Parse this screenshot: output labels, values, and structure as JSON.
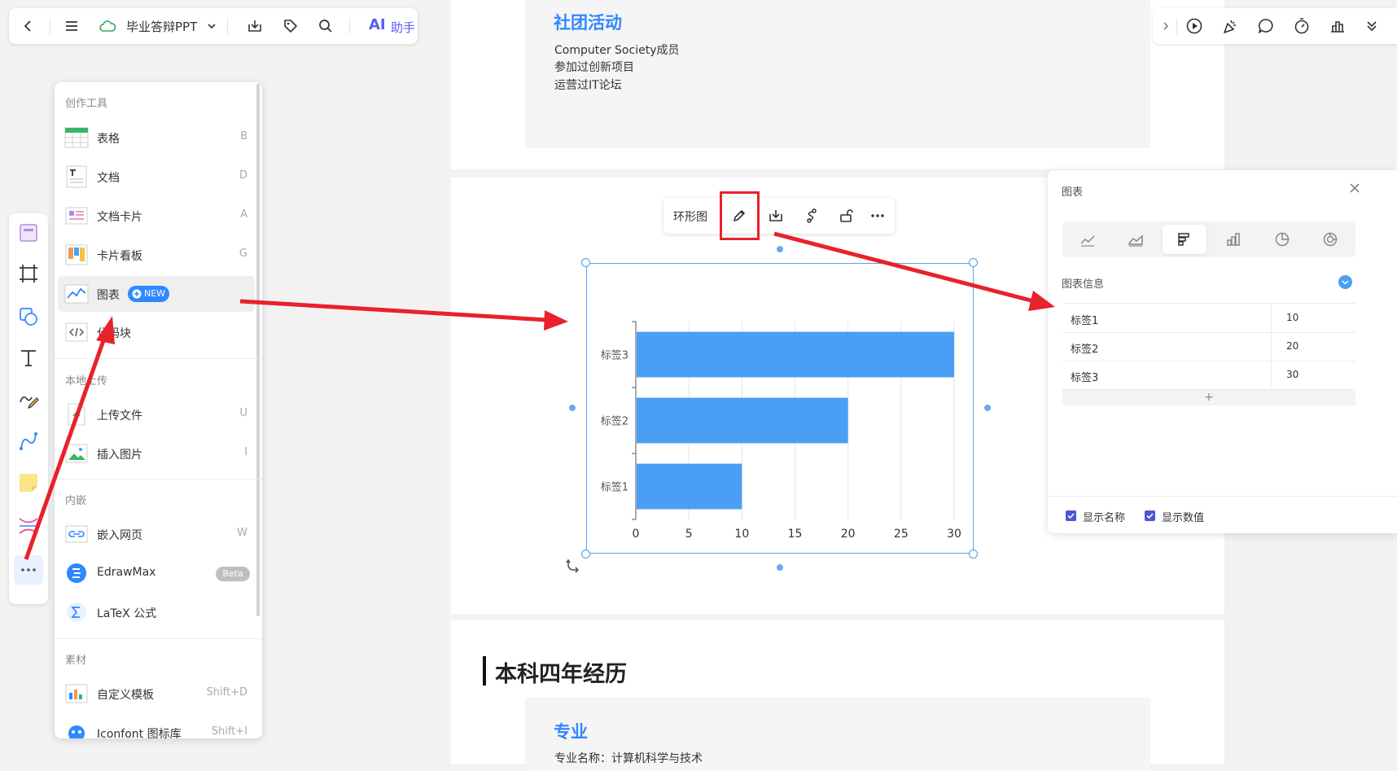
{
  "toolbar": {
    "doc_title": "毕业答辩PPT",
    "ai_label": "AI",
    "ai_sub": "助手"
  },
  "slides": {
    "club": {
      "title": "社团活动",
      "lines": [
        "Computer Society成员",
        "参加过创新项目",
        "运营过IT论坛"
      ]
    },
    "heading": "本科四年经历",
    "major": {
      "title": "专业",
      "line": "专业名称：计算机科学与技术"
    }
  },
  "menu": {
    "sections": [
      "创作工具",
      "本地上传",
      "内嵌",
      "素材"
    ],
    "items": [
      {
        "label": "表格",
        "key": "B"
      },
      {
        "label": "文档",
        "key": "D"
      },
      {
        "label": "文档卡片",
        "key": "A"
      },
      {
        "label": "卡片看板",
        "key": "G"
      },
      {
        "label": "图表",
        "key": ""
      },
      {
        "label": "代码块",
        "key": ""
      },
      {
        "label": "上传文件",
        "key": "U"
      },
      {
        "label": "插入图片",
        "key": "I"
      },
      {
        "label": "嵌入网页",
        "key": "W"
      },
      {
        "label": "EdrawMax",
        "key": ""
      },
      {
        "label": "LaTeX 公式",
        "key": ""
      },
      {
        "label": "自定义模板",
        "key": "Shift+D"
      },
      {
        "label": "Iconfont 图标库",
        "key": "Shift+I"
      }
    ],
    "new_badge": "NEW",
    "beta_badge": "Beta"
  },
  "chart_toolbar": {
    "type_label": "环形图"
  },
  "chart_data": {
    "type": "bar",
    "orientation": "horizontal",
    "categories": [
      "标签1",
      "标签2",
      "标签3"
    ],
    "values": [
      10,
      20,
      30
    ],
    "xlim": [
      0,
      30
    ],
    "xticks": [
      0,
      5,
      10,
      15,
      20,
      25,
      30
    ],
    "grid": true,
    "bar_color": "#4a9ff5"
  },
  "panel": {
    "title": "图表",
    "info_label": "图表信息",
    "rows": [
      {
        "name": "标签1",
        "value": "10"
      },
      {
        "name": "标签2",
        "value": "20"
      },
      {
        "name": "标签3",
        "value": "30"
      }
    ],
    "add_label": "+",
    "show_name_label": "显示名称",
    "show_value_label": "显示数值"
  },
  "colors": {
    "accent": "#2f88ff",
    "annotation_red": "#e8212b",
    "checkbox": "#4b57d6"
  }
}
